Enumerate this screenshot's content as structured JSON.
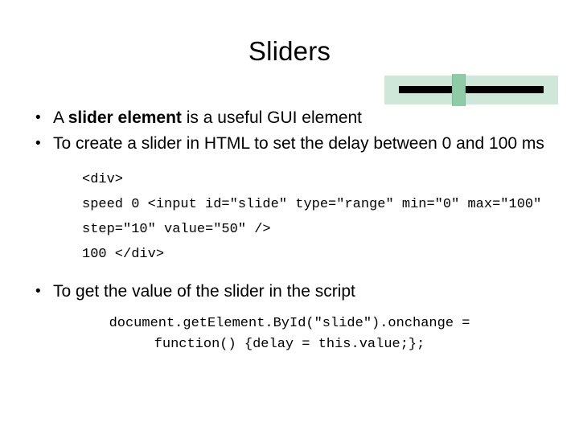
{
  "slide": {
    "title": "Sliders",
    "widget": {
      "name": "slider-control-graphic",
      "track_color": "#cfe7d8",
      "bar_color": "#000000",
      "handle_color": "#8fcba6"
    },
    "bullets": [
      {
        "parts": [
          {
            "text": "A ",
            "bold": false
          },
          {
            "text": "slider element",
            "bold": true
          },
          {
            "text": " is a useful GUI element",
            "bold": false
          }
        ]
      },
      {
        "parts": [
          {
            "text": "To create a slider in HTML to set the delay between 0 and 100 ms",
            "bold": false
          }
        ]
      }
    ],
    "code_block": "<div>\nspeed 0 <input id=\"slide\" type=\"range\" min=\"0\" max=\"100\" step=\"10\" value=\"50\" />\n100 </div>",
    "bullet3": {
      "parts": [
        {
          "text": "To get the value of the slider in the script",
          "bold": false
        }
      ]
    },
    "code_center_line1": "document.getElement.ById(\"slide\").onchange =",
    "code_center_line2": "function() {delay = this.value;};"
  }
}
